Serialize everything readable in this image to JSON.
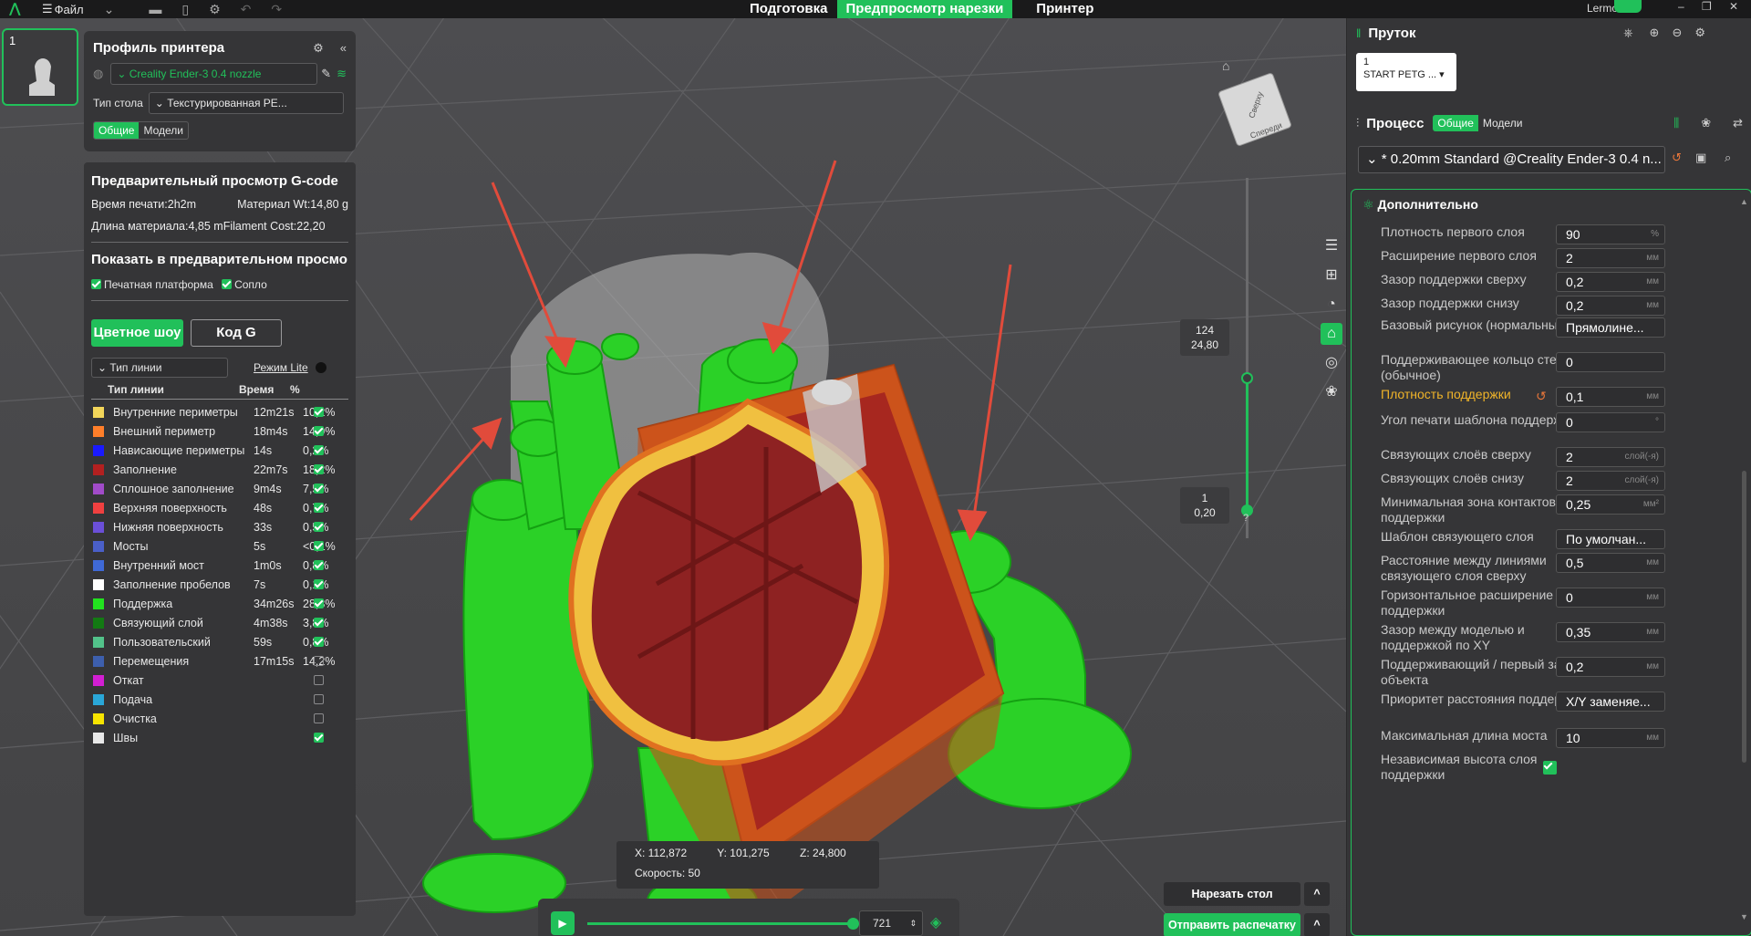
{
  "topbar": {
    "menu_file": "Файл",
    "tabs": [
      "Подготовка",
      "Предпросмотр нарезки",
      "Принтер"
    ],
    "active_tab": "Предпросмотр нарезки",
    "user": "Lermon...",
    "accent": "#21c05a"
  },
  "plate": {
    "number": "1"
  },
  "printer": {
    "title": "Профиль принтера",
    "printer_name": "Creality Ender-3 0.4 nozzle",
    "bed_label": "Тип стола",
    "bed_value": "Текстурированная PE...",
    "tab_general": "Общие",
    "tab_models": "Модели"
  },
  "gcode": {
    "title": "Предварительный просмотр G-code",
    "print_time": "Время печати:2h2m",
    "material_wt": "Материал Wt:14,80 g",
    "material_len": "Длина материала:4,85 m",
    "filament_cost": "Filament Cost:22,20",
    "show_title": "Показать в предварительном просмо",
    "chk_platform": "Печатная платформа",
    "chk_nozzle": "Сопло",
    "btn_color": "Цветное шоу",
    "btn_gcode": "Код G",
    "line_type_select": "Тип линии",
    "lite_mode": "Режим Lite",
    "col_type": "Тип линии",
    "col_time": "Время",
    "col_pct": "%",
    "rows": [
      {
        "name": "Внутренние периметры",
        "time": "12m21s",
        "pct": "10,2%",
        "color": "#f3d65a",
        "checked": true
      },
      {
        "name": "Внешний периметр",
        "time": "18m4s",
        "pct": "14,9%",
        "color": "#ff7f2a",
        "checked": true
      },
      {
        "name": "Нависающие периметры",
        "time": "14s",
        "pct": "0,2%",
        "color": "#1a1aff",
        "checked": true
      },
      {
        "name": "Заполнение",
        "time": "22m7s",
        "pct": "18,2%",
        "color": "#b32020",
        "checked": true
      },
      {
        "name": "Сплошное заполнение",
        "time": "9m4s",
        "pct": "7,5%",
        "color": "#a14bc9",
        "checked": true
      },
      {
        "name": "Верхняя поверхность",
        "time": "48s",
        "pct": "0,7%",
        "color": "#f04040",
        "checked": true
      },
      {
        "name": "Нижняя поверхность",
        "time": "33s",
        "pct": "0,5%",
        "color": "#6b4fd8",
        "checked": true
      },
      {
        "name": "Мосты",
        "time": "5s",
        "pct": "<0,1%",
        "color": "#4a5fc8",
        "checked": true
      },
      {
        "name": "Внутренний мост",
        "time": "1m0s",
        "pct": "0,8%",
        "color": "#3f69d6",
        "checked": true
      },
      {
        "name": "Заполнение пробелов",
        "time": "7s",
        "pct": "0,1%",
        "color": "#ffffff",
        "checked": true
      },
      {
        "name": "Поддержка",
        "time": "34m26s",
        "pct": "28,3%",
        "color": "#22e21f",
        "checked": true
      },
      {
        "name": "Связующий слой",
        "time": "4m38s",
        "pct": "3,8%",
        "color": "#137a13",
        "checked": true
      },
      {
        "name": "Пользовательский",
        "time": "59s",
        "pct": "0,8%",
        "color": "#52c28a",
        "checked": true
      },
      {
        "name": "Перемещения",
        "time": "17m15s",
        "pct": "14,2%",
        "color": "#3d5fad",
        "checked": false
      },
      {
        "name": "Откат",
        "time": "",
        "pct": "",
        "color": "#d21ed2",
        "checked": false
      },
      {
        "name": "Подача",
        "time": "",
        "pct": "",
        "color": "#2aa7d8",
        "checked": false
      },
      {
        "name": "Очистка",
        "time": "",
        "pct": "",
        "color": "#f7e400",
        "checked": false
      },
      {
        "name": "Швы",
        "time": "",
        "pct": "",
        "color": "#e8e8e8",
        "checked": true
      }
    ]
  },
  "layer_slider": {
    "top_layer": "124",
    "top_height": "24,80",
    "bottom_layer": "1",
    "bottom_height": "0,20",
    "help": "?"
  },
  "coords": {
    "x": "X: 112,872",
    "y": "Y: 101,275",
    "z": "Z: 24,800",
    "speed": "Скорость: 50"
  },
  "playback": {
    "move_value": "721"
  },
  "slice_buttons": {
    "slice": "Нарезать стол",
    "send": "Отправить распечатку"
  },
  "navcube": {
    "top": "Сверху",
    "front": "Спереди"
  },
  "right": {
    "filament_title": "Пруток",
    "filament_slot": "1",
    "filament_name": "START PETG ...",
    "process_title": "Процесс",
    "tab_general": "Общие",
    "tab_models": "Модели",
    "profile": "* 0.20mm Standard @Creality Ender-3 0.4 n...",
    "section": "Дополнительно",
    "settings": [
      {
        "label": "Плотность первого слоя",
        "value": "90",
        "unit": "%"
      },
      {
        "label": "Расширение первого слоя",
        "value": "2",
        "unit": "мм"
      },
      {
        "label": "Зазор поддержки сверху",
        "value": "0,2",
        "unit": "мм"
      },
      {
        "label": "Зазор поддержки снизу",
        "value": "0,2",
        "unit": "мм"
      },
      {
        "label": "Базовый рисунок (нормальный)",
        "value": "Прямолине...",
        "unit": ""
      },
      {
        "label": "Поддерживающее кольцо стены (обычное)",
        "value": "0",
        "unit": ""
      },
      {
        "label": "Плотность поддержки",
        "value": "0,1",
        "unit": "мм"
      },
      {
        "label": "Угол печати шаблона поддержки",
        "value": "0",
        "unit": "°"
      },
      {
        "label": "Связующих слоёв сверху",
        "value": "2",
        "unit": "слой(-я)"
      },
      {
        "label": "Связующих слоёв снизу",
        "value": "2",
        "unit": "слой(-я)"
      },
      {
        "label": "Минимальная зона контактов поддержки",
        "value": "0,25",
        "unit": "мм²"
      },
      {
        "label": "Шаблон связующего слоя",
        "value": "По умолчан...",
        "unit": ""
      },
      {
        "label": "Расстояние между линиями связующего слоя сверху",
        "value": "0,5",
        "unit": "мм"
      },
      {
        "label": "Горизонтальное расширение поддержки",
        "value": "0",
        "unit": "мм"
      },
      {
        "label": "Зазор между моделью и поддержкой по XY",
        "value": "0,35",
        "unit": "мм"
      },
      {
        "label": "Поддерживающий / первый зазор объекта",
        "value": "0,2",
        "unit": "мм"
      },
      {
        "label": "Приоритет расстояния поддержки",
        "value": "X/Y заменяе...",
        "unit": ""
      },
      {
        "label": "Максимальная длина моста",
        "value": "10",
        "unit": "мм"
      },
      {
        "label": "Независимая высота слоя поддержки",
        "value": "",
        "unit": ""
      }
    ]
  }
}
